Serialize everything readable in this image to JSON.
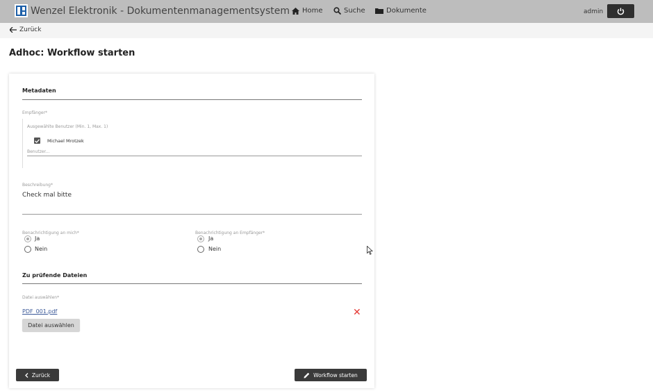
{
  "header": {
    "app_title": "Wenzel Elektronik - Dokumentenmanagementsystem",
    "nav": [
      {
        "label": "Home",
        "icon": "home-icon"
      },
      {
        "label": "Suche",
        "icon": "search-icon"
      },
      {
        "label": "Dokumente",
        "icon": "folder-icon"
      }
    ],
    "user": "admin",
    "logout_icon": "power-icon"
  },
  "subbar": {
    "back_label": "Zurück",
    "back_icon": "arrow-left-icon"
  },
  "page_title": "Adhoc: Workflow starten",
  "form": {
    "metadata_title": "Metadaten",
    "recipients": {
      "label": "Empfänger*",
      "hint": "Ausgewählte Benutzer (Min. 1, Max. 1)",
      "selected_users": [
        "Michael Mrotzek"
      ],
      "input_placeholder": "Benutzer..."
    },
    "description": {
      "label": "Beschreibung*",
      "value": "Check mal bitte"
    },
    "notify_me": {
      "label": "Benachrichtigung an mich*",
      "options": [
        "Ja",
        "Nein"
      ],
      "selected": "Ja"
    },
    "notify_recipients": {
      "label": "Benachrichtigung an Empfänger*",
      "options": [
        "Ja",
        "Nein"
      ],
      "selected": "Ja"
    },
    "files_title": "Zu prüfende Dateien",
    "file_select_label": "Datei auswählen*",
    "files": [
      "PDF_001.pdf"
    ],
    "choose_file_button": "Datei auswählen",
    "back_button": "Zurück",
    "start_button": "Workflow starten"
  },
  "colors": {
    "topbar": "#bdbdbd",
    "logo": "#1d5fa8",
    "remove": "#e53935",
    "dark_button": "#3a3a3a"
  }
}
